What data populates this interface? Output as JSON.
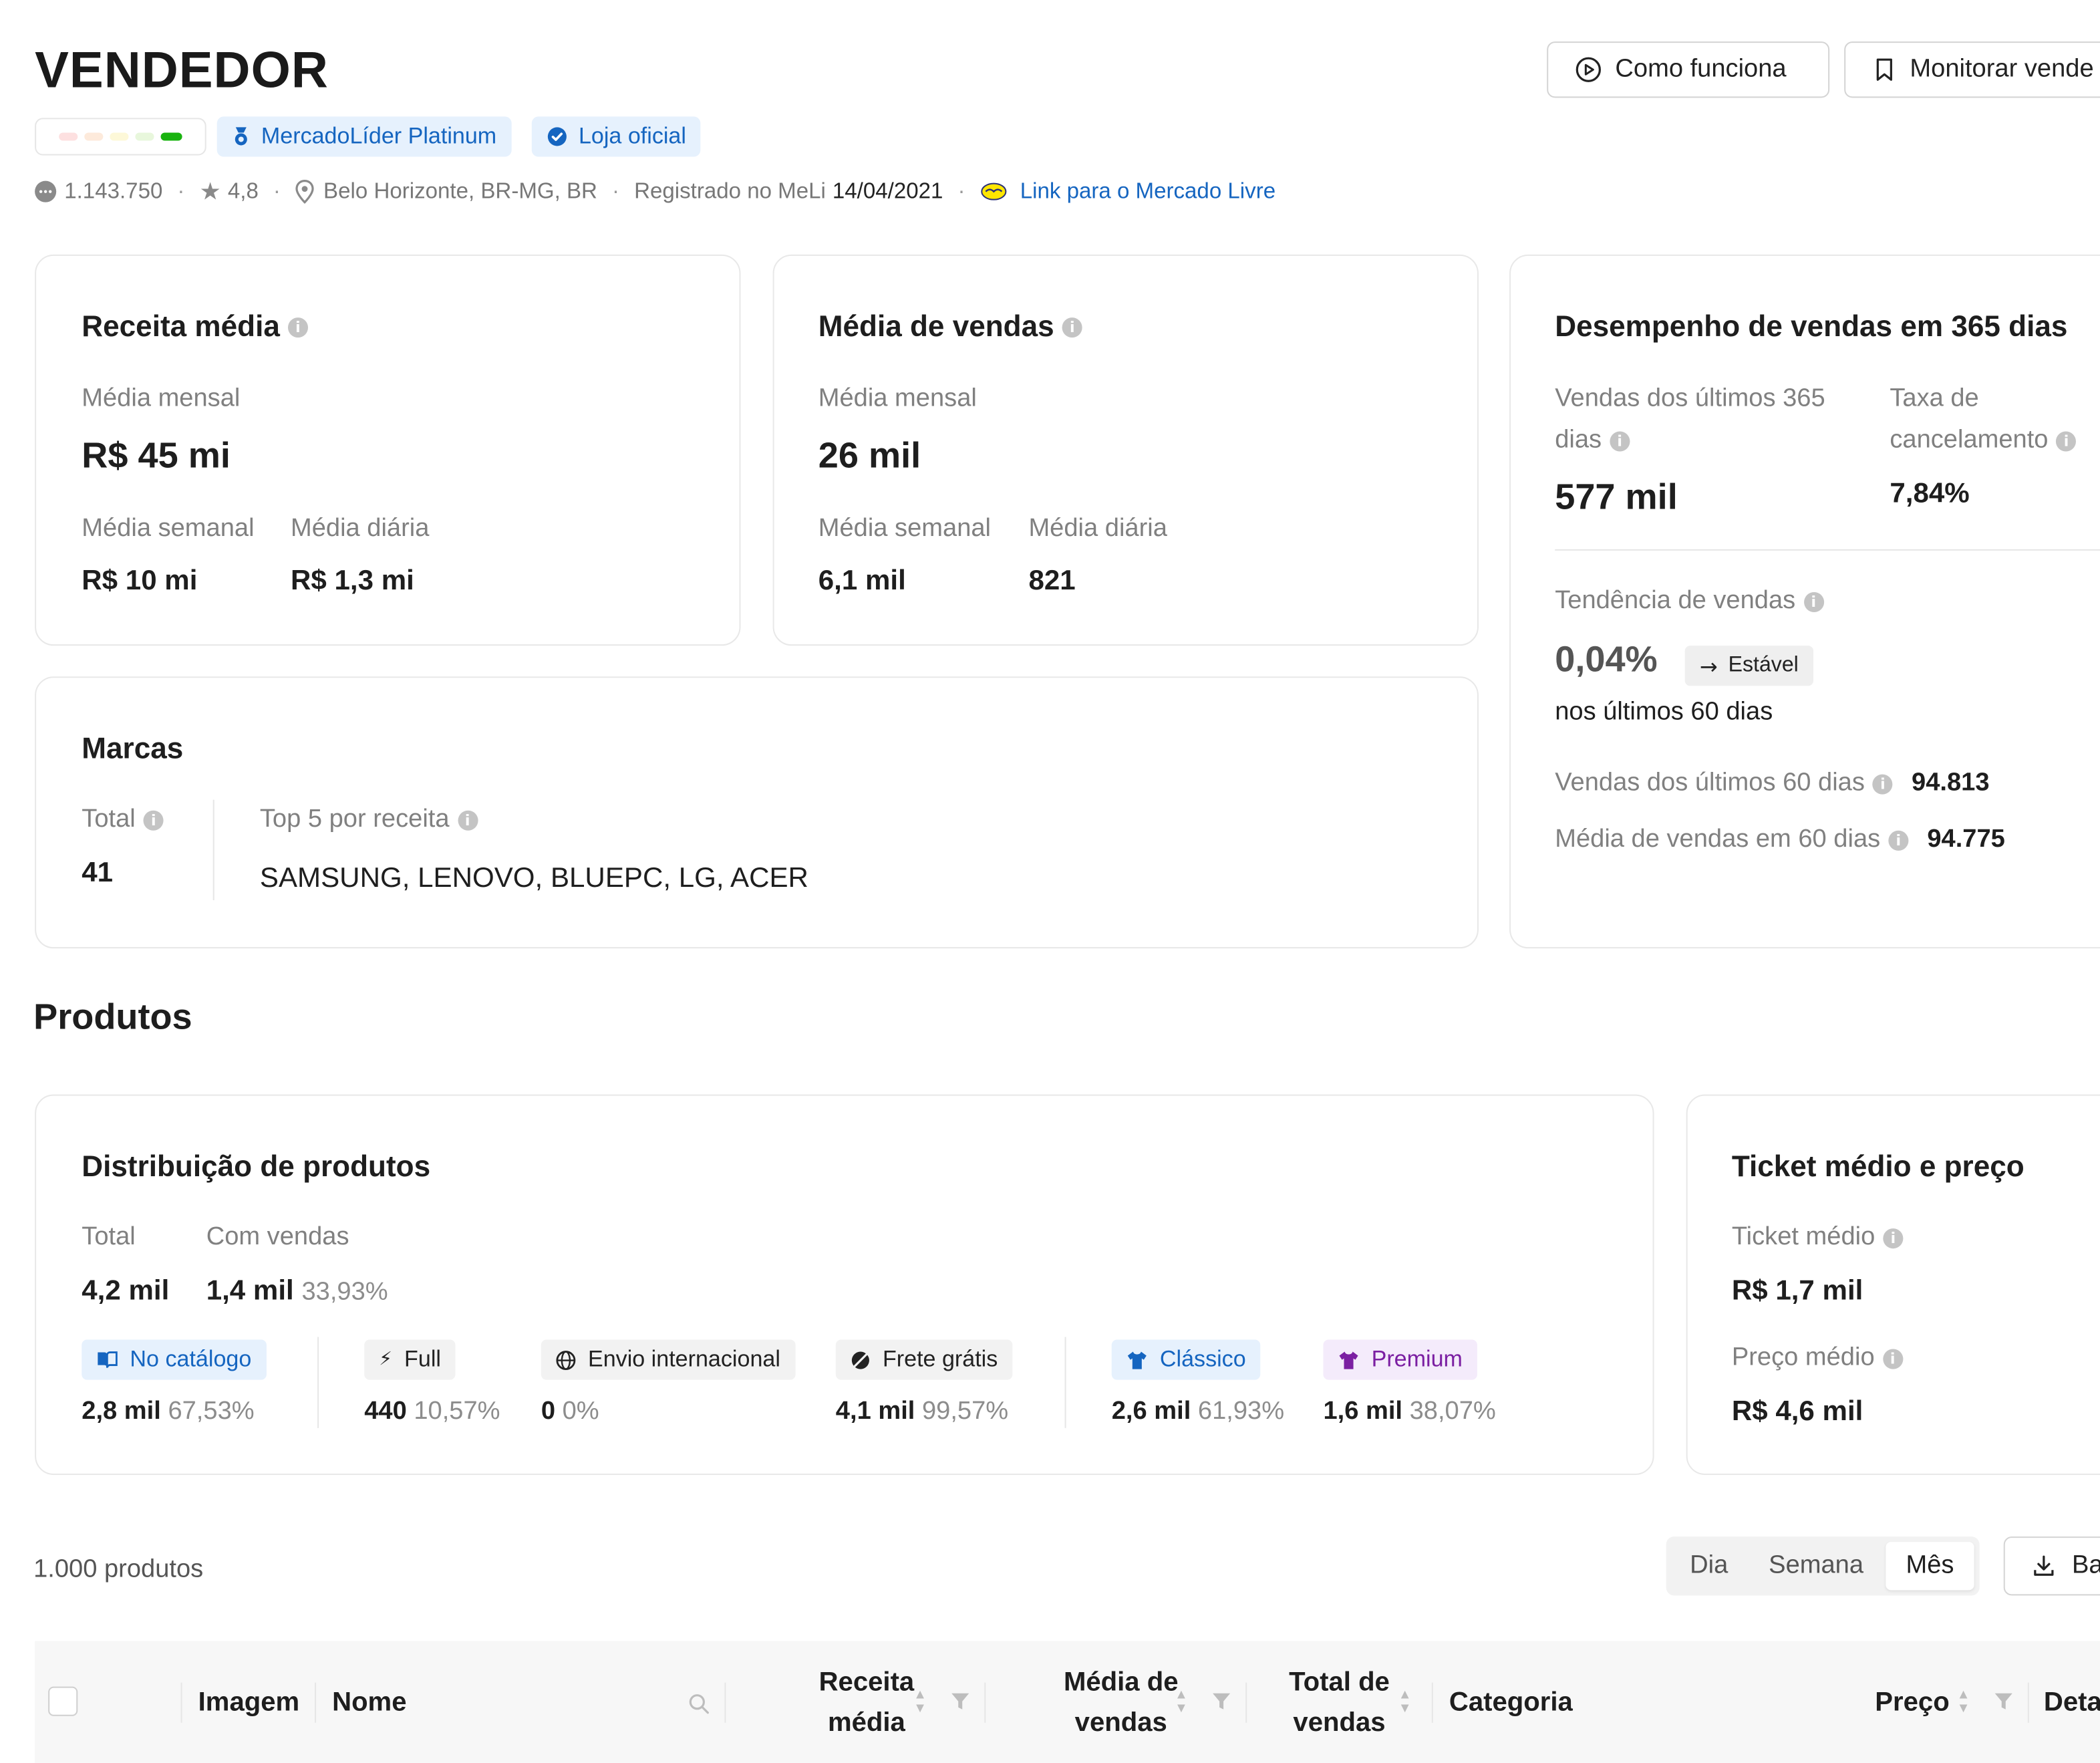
{
  "header": {
    "title": "VENDEDOR",
    "how_it_works": "Como funciona",
    "monitor": "Monitorar vende",
    "reputation_colors": [
      "#fde0e0",
      "#fdeadb",
      "#fdf8d8",
      "#e8f7dc",
      "#19b30f"
    ],
    "badges": {
      "platinum": "MercadoLíder Platinum",
      "official": "Loja oficial"
    },
    "meta": {
      "reviews": "1.143.750",
      "rating": "4,8",
      "location": "Belo Horizonte, BR-MG, BR",
      "registered_label": "Registrado no MeLi",
      "registered_date": "14/04/2021",
      "link": "Link para o Mercado Livre"
    }
  },
  "revenue": {
    "title": "Receita média",
    "monthly_label": "Média mensal",
    "monthly": "R$ 45 mi",
    "weekly_label": "Média semanal",
    "weekly": "R$ 10 mi",
    "daily_label": "Média diária",
    "daily": "R$ 1,3 mi"
  },
  "sales": {
    "title": "Média de vendas",
    "monthly_label": "Média mensal",
    "monthly": "26 mil",
    "weekly_label": "Média semanal",
    "weekly": "6,1 mil",
    "daily_label": "Média diária",
    "daily": "821"
  },
  "performance": {
    "title": "Desempenho de vendas em 365 dias",
    "sales365_label_1": "Vendas dos últimos 365",
    "sales365_label_2": "dias",
    "sales365": "577 mil",
    "cancel_label_1": "Taxa de",
    "cancel_label_2": "cancelamento",
    "cancel": "7,84%",
    "trend_label": "Tendência de vendas",
    "trend": "0,04%",
    "trend_status": "Estável",
    "trend_period": "nos últimos 60 dias",
    "sales60_label": "Vendas dos últimos 60 dias",
    "sales60": "94.813",
    "avg60_label": "Média de vendas em 60 dias",
    "avg60": "94.775"
  },
  "brands": {
    "title": "Marcas",
    "total_label": "Total",
    "total": "41",
    "top_label": "Top 5 por receita",
    "top": "SAMSUNG, LENOVO, BLUEPC, LG, ACER"
  },
  "products_section": {
    "title": "Produtos"
  },
  "distribution": {
    "title": "Distribuição de produtos",
    "total_label": "Total",
    "total": "4,2 mil",
    "with_sales_label": "Com vendas",
    "with_sales": "1,4 mil",
    "with_sales_pct": "33,93%",
    "chips": {
      "catalog": {
        "label": "No catálogo",
        "value": "2,8 mil",
        "pct": "67,53%"
      },
      "full": {
        "label": "Full",
        "value": "440",
        "pct": "10,57%"
      },
      "intl": {
        "label": "Envio internacional",
        "value": "0",
        "pct": "0%"
      },
      "free": {
        "label": "Frete grátis",
        "value": "4,1 mil",
        "pct": "99,57%"
      },
      "classic": {
        "label": "Clássico",
        "value": "2,6 mil",
        "pct": "61,93%"
      },
      "premium": {
        "label": "Premium",
        "value": "1,6 mil",
        "pct": "38,07%"
      }
    }
  },
  "ticket": {
    "title": "Ticket médio e preço",
    "ticket_label": "Ticket médio",
    "ticket": "R$ 1,7 mil",
    "price_label": "Preço médio",
    "price": "R$ 4,6 mil"
  },
  "table": {
    "count": "1.000 produtos",
    "period": {
      "day": "Dia",
      "week": "Semana",
      "month": "Mês",
      "selected": "Mês"
    },
    "download": "Ba",
    "columns": {
      "image": "Imagem",
      "name": "Nome",
      "revenue_1": "Receita",
      "revenue_2": "média",
      "avgsales_1": "Média de",
      "avgsales_2": "vendas",
      "totalsales_1": "Total de",
      "totalsales_2": "vendas",
      "category": "Categoria",
      "price": "Preço",
      "details": "Deta"
    }
  }
}
